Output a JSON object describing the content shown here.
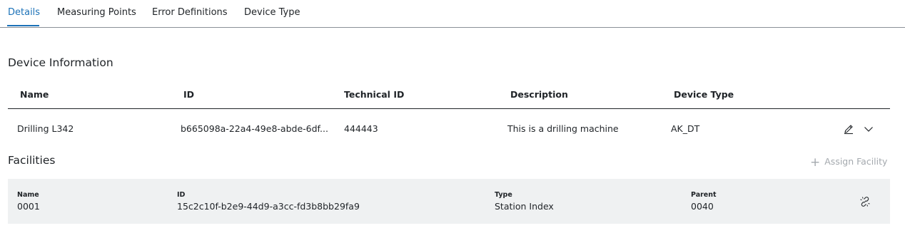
{
  "tabs": [
    {
      "label": "Details",
      "active": true
    },
    {
      "label": "Measuring Points",
      "active": false
    },
    {
      "label": "Error Definitions",
      "active": false
    },
    {
      "label": "Device Type",
      "active": false
    }
  ],
  "device_info": {
    "title": "Device Information",
    "columns": [
      "Name",
      "ID",
      "Technical ID",
      "Description",
      "Device Type"
    ],
    "row": {
      "name": "Drilling L342",
      "id": "b665098a-22a4-49e8-abde-6df...",
      "technical_id": "444443",
      "description": "This is a drilling machine",
      "device_type": "AK_DT"
    },
    "icons": [
      "pencil-icon",
      "chevron-down-icon"
    ]
  },
  "facilities": {
    "title": "Facilities",
    "assign_label": "Assign Facility",
    "item": {
      "name_label": "Name",
      "name": "0001",
      "id_label": "ID",
      "id": "15c2c10f-b2e9-44d9-a3cc-fd3b8bb29fa9",
      "type_label": "Type",
      "type": "Station Index",
      "parent_label": "Parent",
      "parent": "0040"
    },
    "unlink_icon": "unlink-icon"
  },
  "colors": {
    "accent": "#1c72b8",
    "card_bg": "#eff1f2",
    "disabled_text": "#a4a9ae"
  }
}
